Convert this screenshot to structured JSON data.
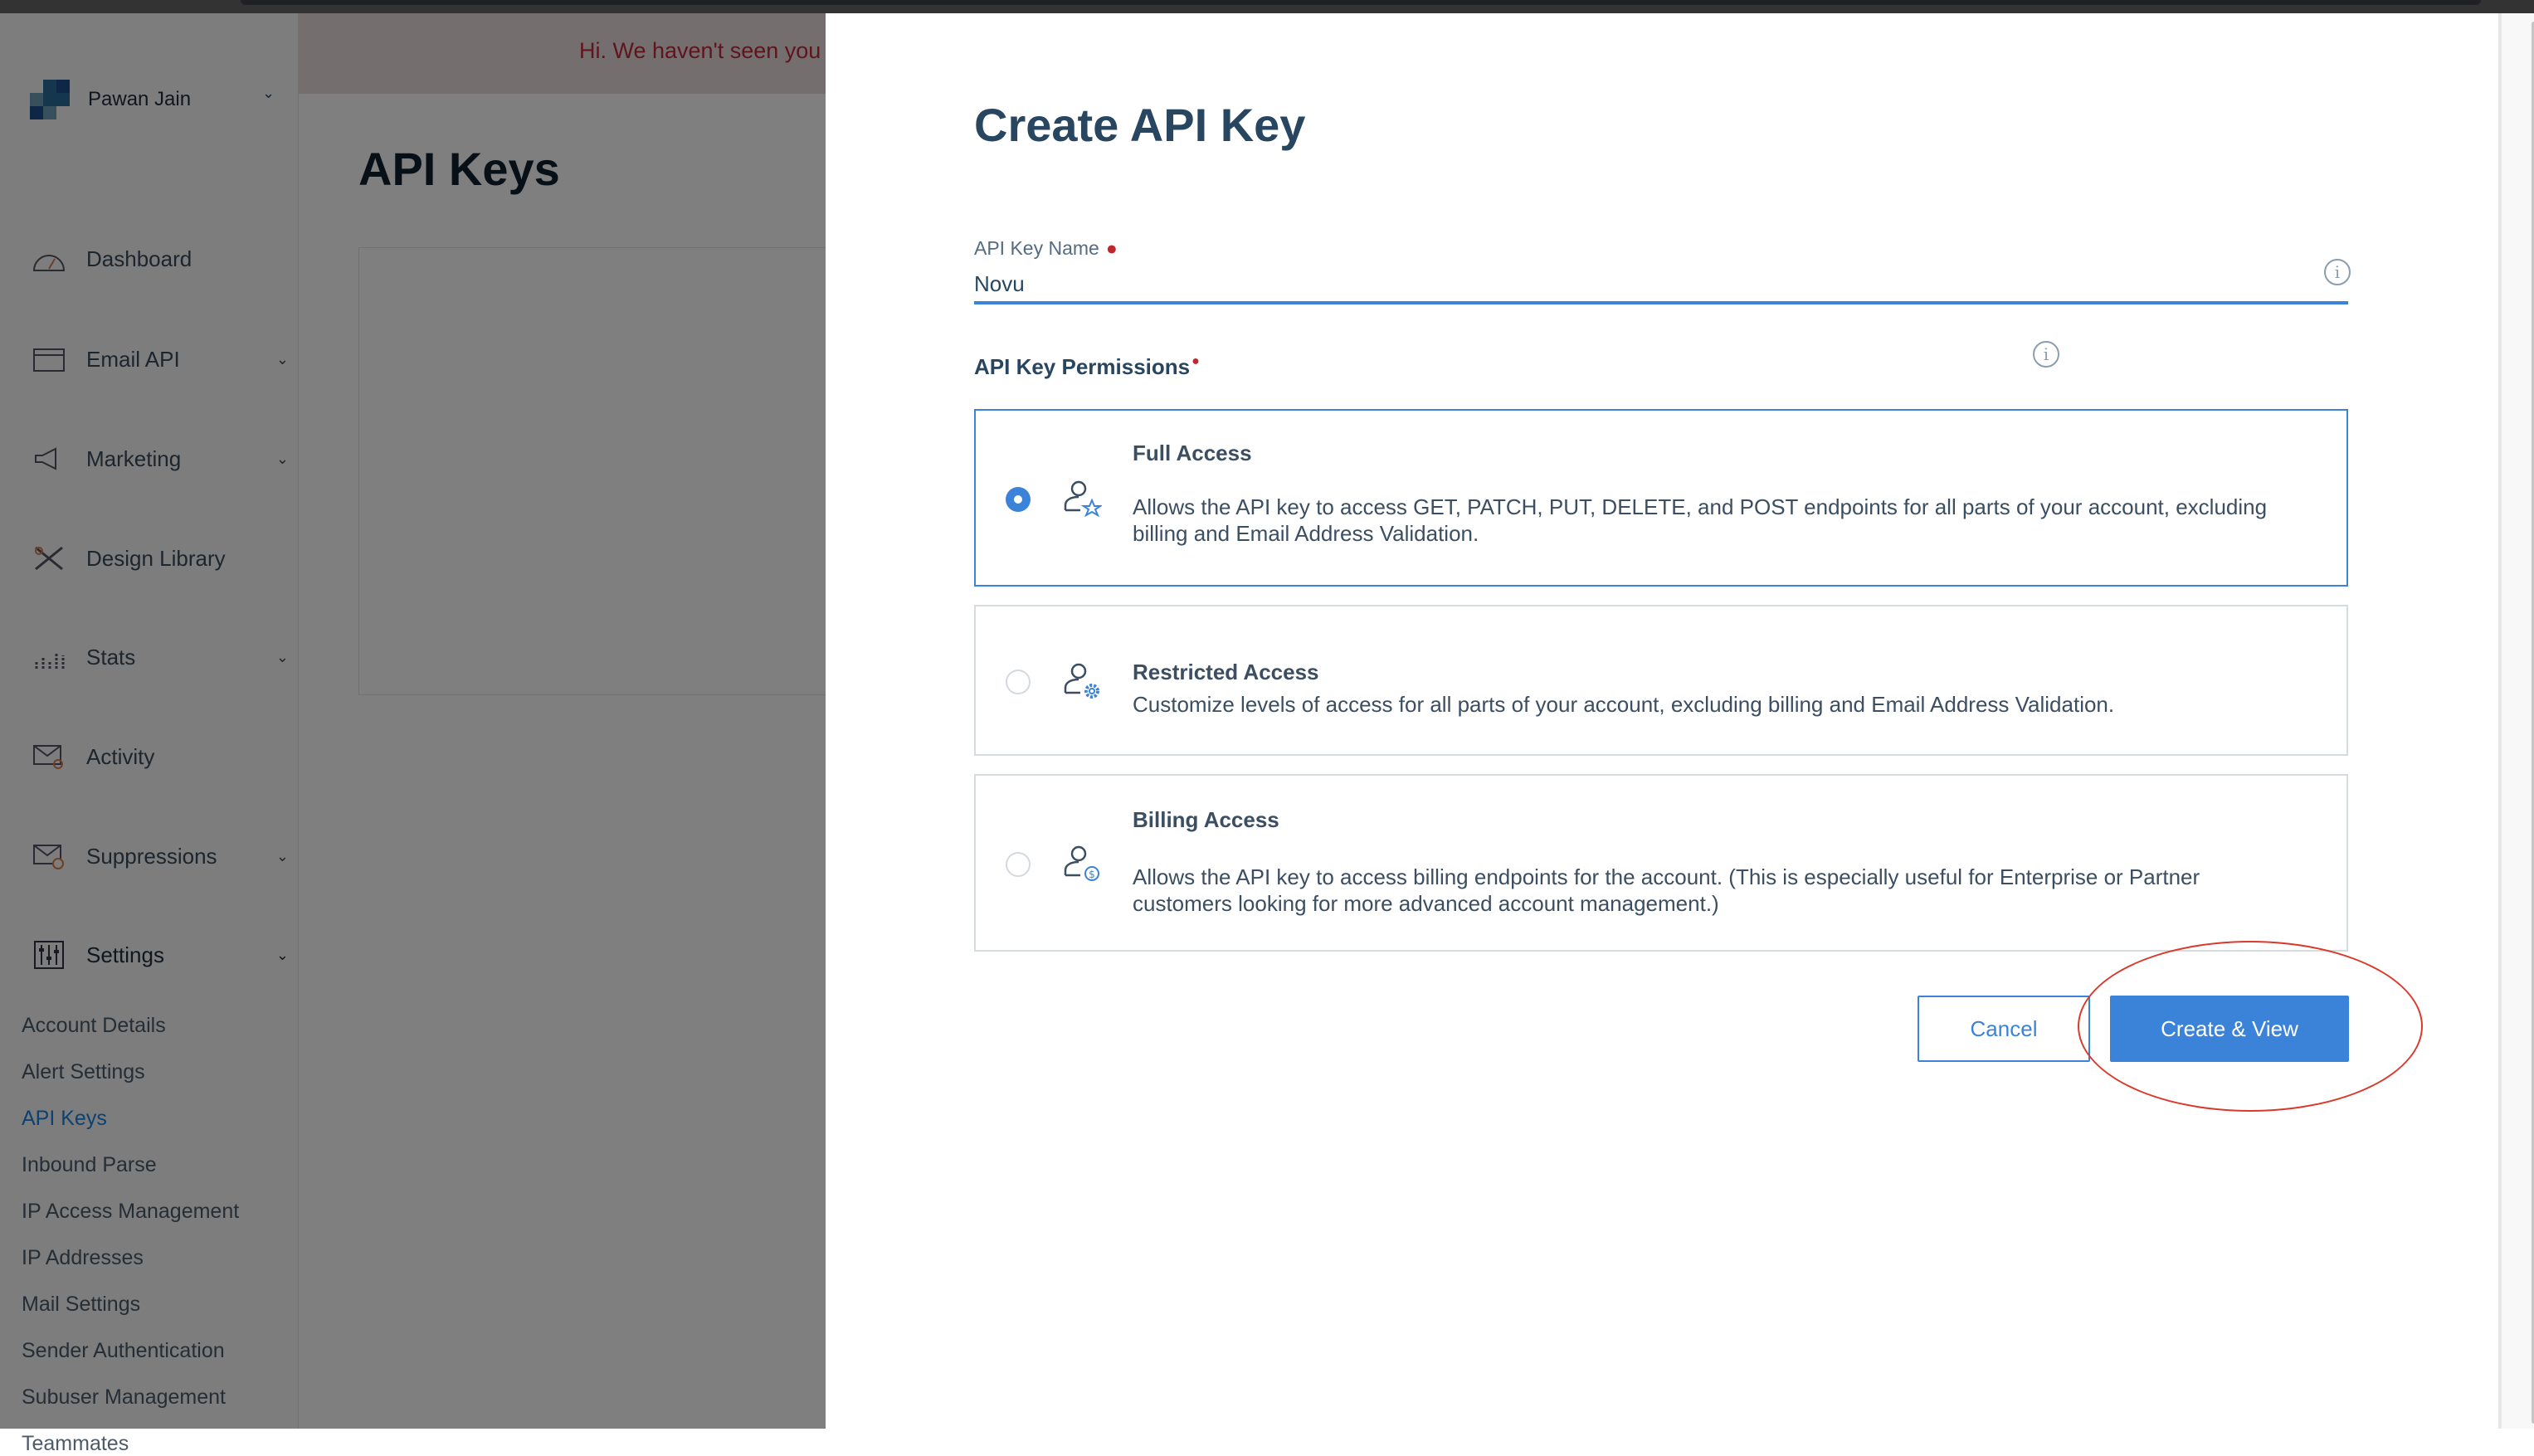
{
  "account": {
    "name": "Pawan Jain"
  },
  "sidebar": {
    "items": [
      {
        "label": "Dashboard",
        "icon": "dashboard-gauge-icon",
        "expandable": false
      },
      {
        "label": "Email API",
        "icon": "email-api-icon",
        "expandable": true
      },
      {
        "label": "Marketing",
        "icon": "megaphone-icon",
        "expandable": true
      },
      {
        "label": "Design Library",
        "icon": "design-tools-icon",
        "expandable": false
      },
      {
        "label": "Stats",
        "icon": "bar-chart-icon",
        "expandable": true
      },
      {
        "label": "Activity",
        "icon": "envelope-search-icon",
        "expandable": false
      },
      {
        "label": "Suppressions",
        "icon": "envelope-block-icon",
        "expandable": true
      },
      {
        "label": "Settings",
        "icon": "sliders-icon",
        "expandable": true
      }
    ],
    "settings_items": [
      "Account Details",
      "Alert Settings",
      "API Keys",
      "Inbound Parse",
      "IP Access Management",
      "IP Addresses",
      "Mail Settings",
      "Sender Authentication",
      "Subuser Management",
      "Teammates"
    ],
    "active_item": "API Keys"
  },
  "banner": {
    "text": "Hi. We haven't seen you"
  },
  "page": {
    "title": "API Keys"
  },
  "modal": {
    "title": "Create API Key",
    "name_label": "API Key Name",
    "name_value": "Novu",
    "permissions_label": "API Key Permissions",
    "options": [
      {
        "title": "Full Access",
        "description": "Allows the API key to access GET, PATCH, PUT, DELETE, and POST endpoints for all parts of your account, excluding billing and Email Address Validation.",
        "selected": true,
        "icon": "user-star-icon"
      },
      {
        "title": "Restricted Access",
        "description": "Customize levels of access for all parts of your account, excluding billing and Email Address Validation.",
        "selected": false,
        "icon": "user-gear-icon"
      },
      {
        "title": "Billing Access",
        "description": "Allows the API key to access billing endpoints for the account. (This is especially useful for Enterprise or Partner customers looking for more advanced account management.)",
        "selected": false,
        "icon": "user-dollar-icon"
      }
    ],
    "cancel_label": "Cancel",
    "create_label": "Create & View"
  },
  "colors": {
    "accent": "#3b83d9",
    "required": "#c0272d",
    "annotation": "#d93a2b"
  }
}
